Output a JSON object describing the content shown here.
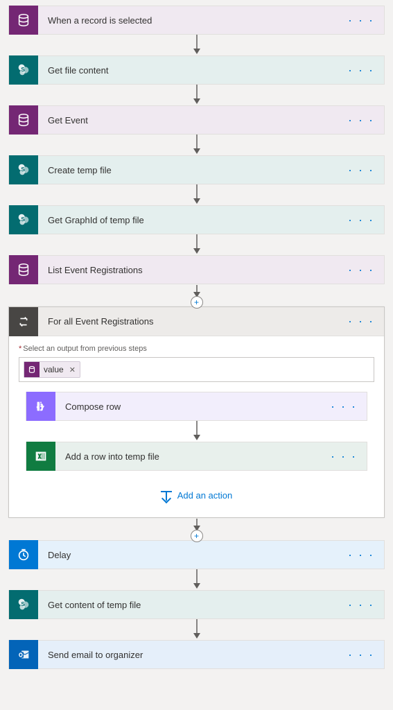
{
  "steps": {
    "trigger": {
      "title": "When a record is selected"
    },
    "getFile": {
      "title": "Get file content"
    },
    "getEvent": {
      "title": "Get Event"
    },
    "createTemp": {
      "title": "Create temp file"
    },
    "getGraphId": {
      "title": "Get GraphId of temp file"
    },
    "listRegs": {
      "title": "List Event Registrations"
    },
    "foreach": {
      "title": "For all Event Registrations"
    },
    "composeRow": {
      "title": "Compose row"
    },
    "addRow": {
      "title": "Add a row into temp file"
    },
    "delay": {
      "title": "Delay"
    },
    "getTempContent": {
      "title": "Get content of temp file"
    },
    "sendEmail": {
      "title": "Send email to organizer"
    }
  },
  "foreachField": {
    "label": "Select an output from previous steps",
    "tokenLabel": "value"
  },
  "links": {
    "addAction": "Add an action"
  },
  "glyphs": {
    "ellipsis": "· · ·",
    "plus": "+"
  }
}
